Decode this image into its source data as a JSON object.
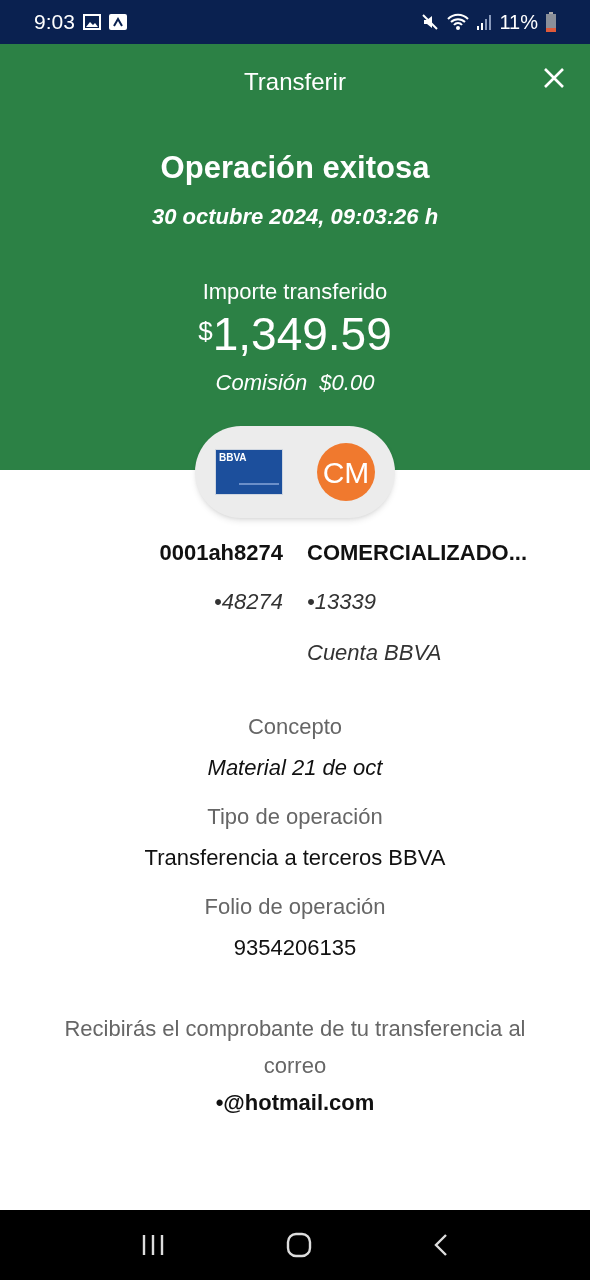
{
  "status_bar": {
    "time": "9:03",
    "battery": "11%"
  },
  "header": {
    "title": "Transferir",
    "status": "Operación exitosa",
    "date": "30 octubre 2024, 09:03:26 h",
    "amount_label": "Importe transferido",
    "currency": "$",
    "amount": "1,349.59",
    "fee_label": "Comisión",
    "fee": "$0.00"
  },
  "origin": {
    "card_brand": "BBVA",
    "name": "0001ah8274",
    "account": "•48274"
  },
  "destination": {
    "initials": "CM",
    "name": "COMERCIALIZADO...",
    "account": "•13339",
    "bank": "Cuenta BBVA"
  },
  "details": [
    {
      "label": "Concepto",
      "value": "Material 21 de oct",
      "italic": true
    },
    {
      "label": "Tipo de operación",
      "value": "Transferencia a terceros BBVA",
      "italic": false
    },
    {
      "label": "Folio de operación",
      "value": "9354206135",
      "italic": false
    }
  ],
  "notice": {
    "text": "Recibirás el comprobante de tu transferencia al correo",
    "email": "•@hotmail.com"
  }
}
